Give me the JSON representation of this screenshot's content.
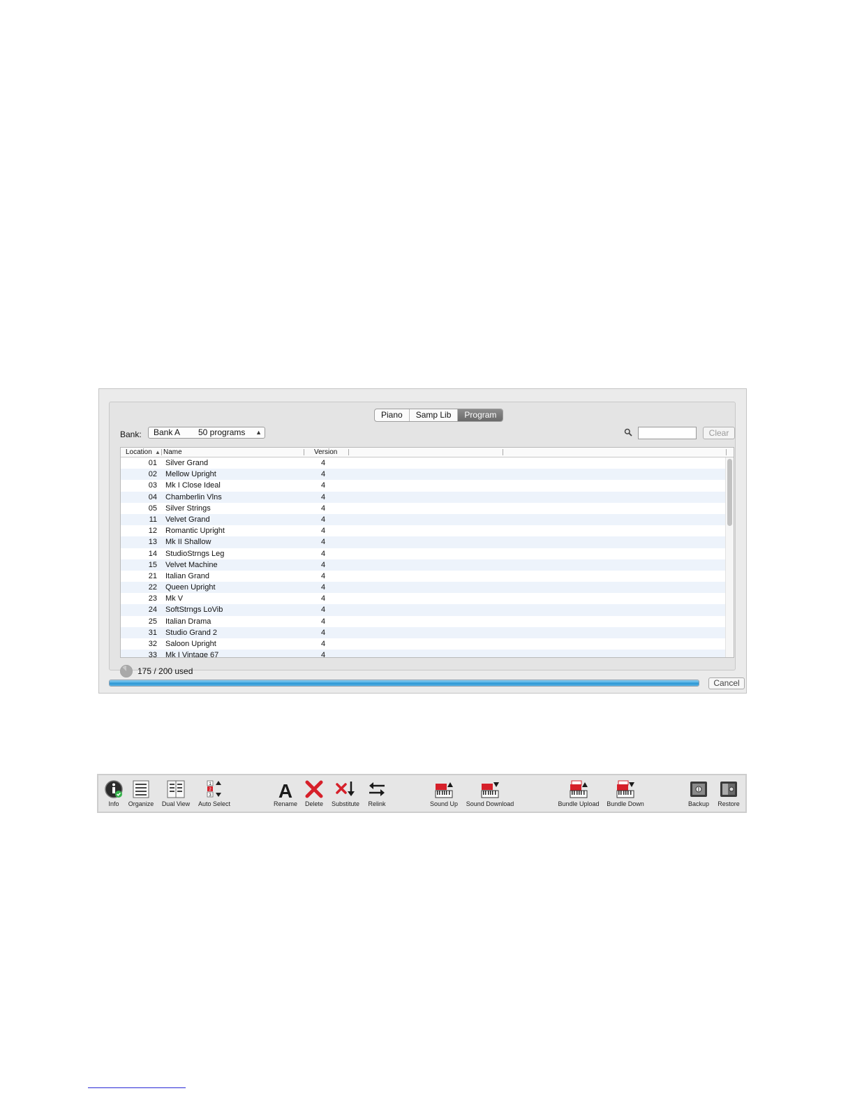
{
  "tabs": [
    {
      "label": "Piano",
      "active": false
    },
    {
      "label": "Samp Lib",
      "active": false
    },
    {
      "label": "Program",
      "active": true
    }
  ],
  "bank": {
    "label": "Bank:",
    "selected": "Bank A",
    "count": "50 programs"
  },
  "search": {
    "value": "",
    "placeholder": ""
  },
  "clear_label": "Clear",
  "table": {
    "columns": [
      "Location",
      "Name",
      "Version"
    ],
    "sorted_column": "Location",
    "rows": [
      {
        "location": "01",
        "name": "Silver Grand",
        "version": "4"
      },
      {
        "location": "02",
        "name": "Mellow Upright",
        "version": "4"
      },
      {
        "location": "03",
        "name": "Mk I Close Ideal",
        "version": "4"
      },
      {
        "location": "04",
        "name": "Chamberlin Vlns",
        "version": "4"
      },
      {
        "location": "05",
        "name": "Silver Strings",
        "version": "4"
      },
      {
        "location": "11",
        "name": "Velvet Grand",
        "version": "4"
      },
      {
        "location": "12",
        "name": "Romantic Upright",
        "version": "4"
      },
      {
        "location": "13",
        "name": "Mk II Shallow",
        "version": "4"
      },
      {
        "location": "14",
        "name": "StudioStrngs Leg",
        "version": "4"
      },
      {
        "location": "15",
        "name": "Velvet Machine",
        "version": "4"
      },
      {
        "location": "21",
        "name": "Italian Grand",
        "version": "4"
      },
      {
        "location": "22",
        "name": "Queen Upright",
        "version": "4"
      },
      {
        "location": "23",
        "name": "Mk V",
        "version": "4"
      },
      {
        "location": "24",
        "name": "SoftStrngs LoVib",
        "version": "4"
      },
      {
        "location": "25",
        "name": "Italian Drama",
        "version": "4"
      },
      {
        "location": "31",
        "name": "Studio Grand 2",
        "version": "4"
      },
      {
        "location": "32",
        "name": "Saloon Upright",
        "version": "4"
      },
      {
        "location": "33",
        "name": "Mk I Vintage 67",
        "version": "4"
      }
    ]
  },
  "usage": {
    "text": "175 / 200 used",
    "used": 175,
    "total": 200
  },
  "progress": {
    "fraction": 1.0
  },
  "cancel_label": "Cancel",
  "toolbar": [
    {
      "id": "info",
      "label": "Info",
      "icon": "info-icon"
    },
    {
      "id": "organize",
      "label": "Organize",
      "icon": "list-icon"
    },
    {
      "id": "dual-view",
      "label": "Dual View",
      "icon": "dual-list-icon"
    },
    {
      "id": "auto-select",
      "label": "Auto Select",
      "icon": "numbered-list-icon"
    },
    {
      "id": "rename",
      "label": "Rename",
      "icon": "letter-a-icon"
    },
    {
      "id": "delete",
      "label": "Delete",
      "icon": "red-x-icon"
    },
    {
      "id": "substitute",
      "label": "Substitute",
      "icon": "substitute-icon"
    },
    {
      "id": "relink",
      "label": "Relink",
      "icon": "relink-arrows-icon"
    },
    {
      "id": "sound-up",
      "label": "Sound Up",
      "icon": "keyboard-up-icon"
    },
    {
      "id": "sound-download",
      "label": "Sound Download",
      "icon": "keyboard-down-icon"
    },
    {
      "id": "bundle-upload",
      "label": "Bundle Upload",
      "icon": "bundle-up-icon"
    },
    {
      "id": "bundle-down",
      "label": "Bundle Down",
      "icon": "bundle-down-icon"
    },
    {
      "id": "backup",
      "label": "Backup",
      "icon": "safe-icon"
    },
    {
      "id": "restore",
      "label": "Restore",
      "icon": "open-safe-icon"
    }
  ],
  "colors": {
    "accent": "#2b96d4",
    "brand_red": "#d6202a",
    "row_alt": "#edf3fb"
  }
}
